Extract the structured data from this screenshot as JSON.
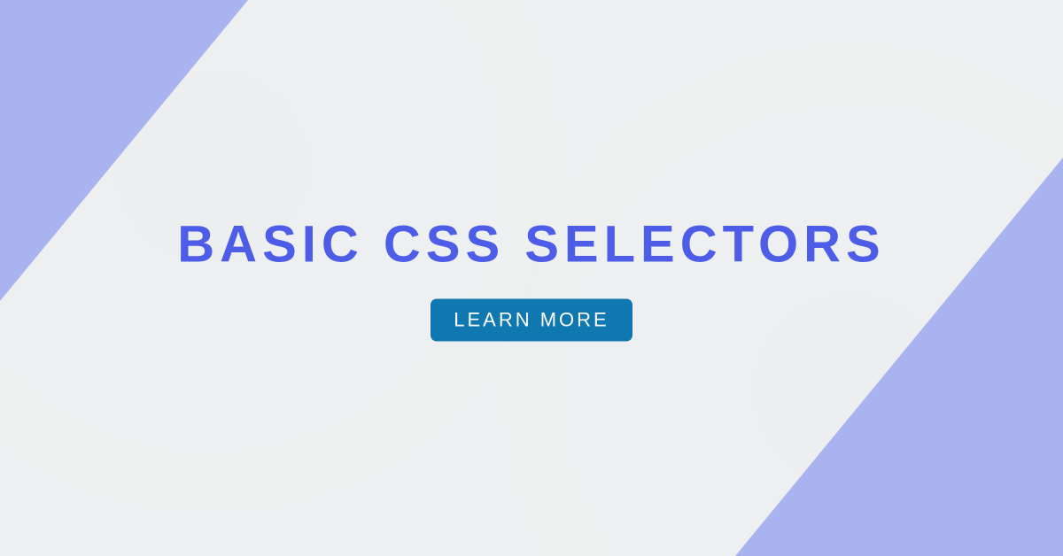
{
  "title": "BASIC CSS SELECTORS",
  "cta": {
    "label": "LEARN MORE"
  },
  "colors": {
    "accent_corners": "#a9b3f0",
    "title": "#4d5de8",
    "button_bg": "#1078b0",
    "button_text": "#ffffff",
    "background": "#eef0f1"
  }
}
